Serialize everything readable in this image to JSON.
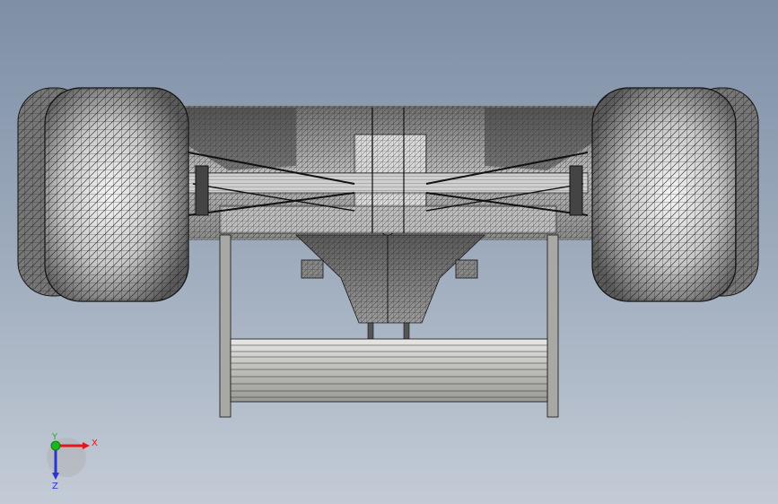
{
  "viewport": {
    "background_top": "#7e8fa6",
    "background_bottom": "#c3cbd6",
    "mesh_color": "#1a1a1a",
    "shade_light": "#f2f2f2",
    "shade_dark": "#5c5c5c"
  },
  "triad": {
    "x_label": "X",
    "y_label": "Y",
    "z_label": "Z",
    "x_color": "#e8141b",
    "y_color": "#18b818",
    "z_color": "#2a34d4"
  }
}
